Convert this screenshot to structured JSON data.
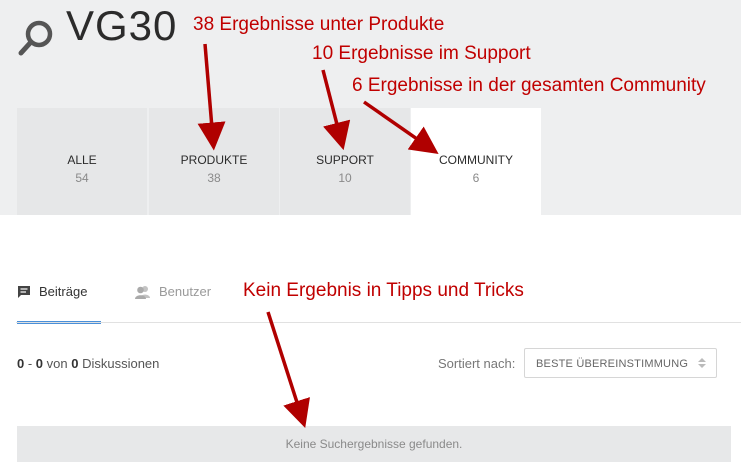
{
  "header": {
    "query": "VG30"
  },
  "tabs": [
    {
      "label": "ALLE",
      "count": "54"
    },
    {
      "label": "PRODUKTE",
      "count": "38"
    },
    {
      "label": "SUPPORT",
      "count": "10"
    },
    {
      "label": "COMMUNITY",
      "count": "6"
    }
  ],
  "subtabs": {
    "posts": "Beiträge",
    "users": "Benutzer"
  },
  "results": {
    "from": "0",
    "sep": " - ",
    "to": "0",
    "of": " von ",
    "total": "0",
    "unit": " Diskussionen"
  },
  "sort": {
    "label": "Sortiert nach:",
    "value": "BESTE ÜBEREINSTIMMUNG"
  },
  "empty_message": "Keine Suchergebnisse gefunden.",
  "annotations": {
    "products": "38 Ergebnisse unter Produkte",
    "support": "10 Ergebnisse im Support",
    "community": "6 Ergebnisse in der gesamten Community",
    "tips": "Kein Ergebnis in Tipps und Tricks"
  },
  "colors": {
    "annotation": "#c00000",
    "accent": "#4a90d9"
  }
}
